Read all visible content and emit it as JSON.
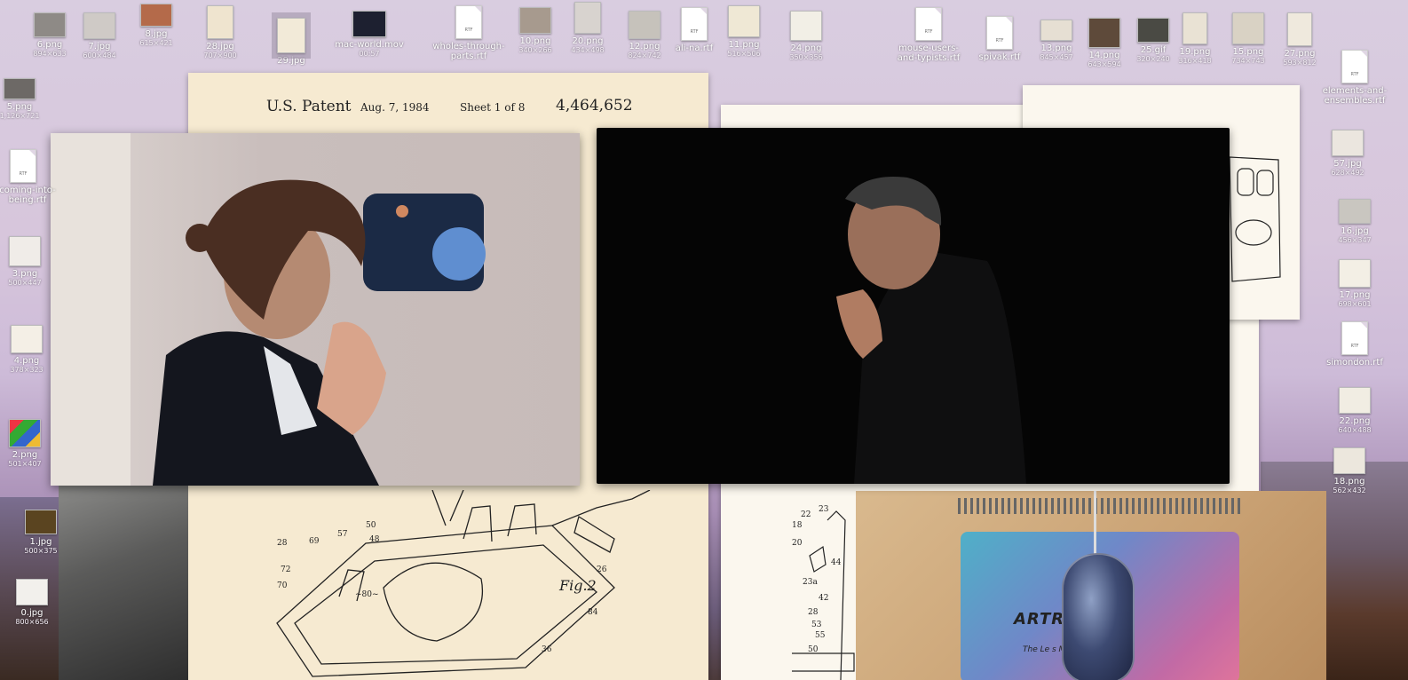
{
  "desktop": {
    "icons_top": [
      {
        "name": "6.png",
        "dims": "894×633"
      },
      {
        "name": "7.jpg",
        "dims": "600×484"
      },
      {
        "name": "8.jpg",
        "dims": "615×421"
      },
      {
        "name": "28.jpg",
        "dims": "707×900"
      },
      {
        "name": "29.jpg",
        "dims": ""
      },
      {
        "name": "mac-world.mov",
        "dims": "00:57"
      },
      {
        "name": "wholes-through-parts.rtf",
        "dims": ""
      },
      {
        "name": "10.png",
        "dims": "340×266"
      },
      {
        "name": "20.png",
        "dims": "434×498"
      },
      {
        "name": "12.png",
        "dims": "824×742"
      },
      {
        "name": "ali-na.rtf",
        "dims": ""
      },
      {
        "name": "11.png",
        "dims": "516×506"
      },
      {
        "name": "24.png",
        "dims": "350×356"
      },
      {
        "name": "mouse-users-and-typists.rtf",
        "dims": ""
      },
      {
        "name": "spivak.rtf",
        "dims": ""
      },
      {
        "name": "13.png",
        "dims": "845×457"
      },
      {
        "name": "14.png",
        "dims": "643×594"
      },
      {
        "name": "25.gif",
        "dims": "320×240"
      },
      {
        "name": "19.png",
        "dims": "316×418"
      },
      {
        "name": "15.png",
        "dims": "734×743"
      },
      {
        "name": "27.png",
        "dims": "593×812"
      }
    ],
    "icons_left": [
      {
        "name": "5.png",
        "dims": "1,126×721"
      },
      {
        "name": "coming-into-being.rtf",
        "dims": ""
      },
      {
        "name": "3.png",
        "dims": "500×447"
      },
      {
        "name": "4.png",
        "dims": "378×323"
      },
      {
        "name": "2.png",
        "dims": "501×407"
      },
      {
        "name": "1.jpg",
        "dims": "500×375"
      },
      {
        "name": "0.jpg",
        "dims": "800×656"
      }
    ],
    "icons_right": [
      {
        "name": "elements-and-ensembles.rtf",
        "dims": ""
      },
      {
        "name": "57.jpg",
        "dims": "628×492"
      },
      {
        "name": "16.jpg",
        "dims": "456×347"
      },
      {
        "name": "17.png",
        "dims": "698×601"
      },
      {
        "name": "simondon.rtf",
        "dims": ""
      },
      {
        "name": "22.png",
        "dims": "640×488"
      },
      {
        "name": "18.png",
        "dims": "562×432"
      }
    ]
  },
  "patent": {
    "title": "U.S. Patent",
    "date": "Aug. 7, 1984",
    "sheet": "Sheet 1 of 8",
    "number": "4,464,652",
    "figure": "Fig.2"
  },
  "mousepad": {
    "brand": "ARTRIX",
    "tagline": "The Le          s Multimedia"
  },
  "colors": {
    "paper": "#f6ead1",
    "video_bg": "#050505",
    "desktop_top": "#d9cde0"
  }
}
